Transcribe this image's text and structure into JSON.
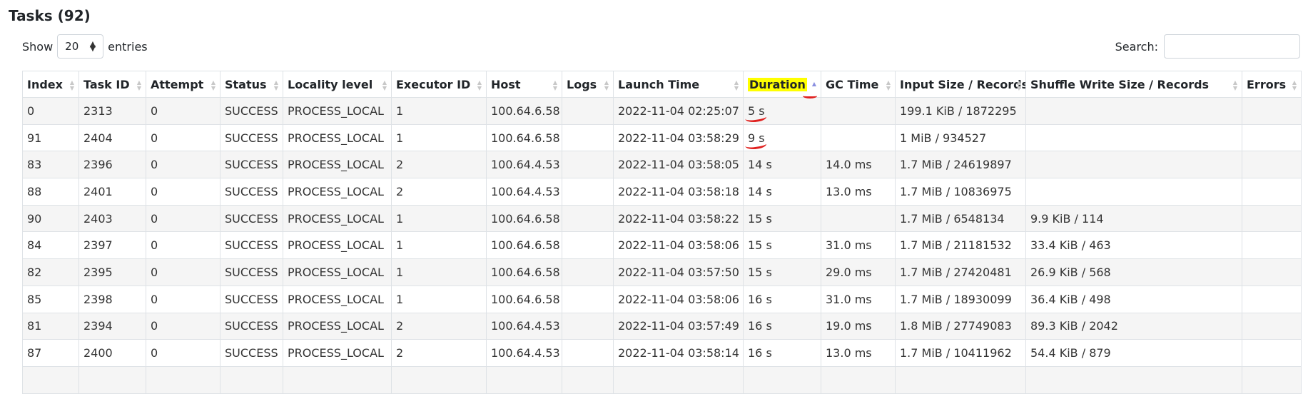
{
  "header": {
    "title": "Tasks (92)"
  },
  "length_menu": {
    "show_label": "Show",
    "value": "20",
    "entries_label": "entries"
  },
  "search": {
    "label": "Search:",
    "value": "",
    "placeholder": ""
  },
  "table": {
    "sorted_column": "Duration",
    "sort_direction": "ascending",
    "highlight_color": "#ffff00",
    "annotation_color": "#e0201e",
    "columns": [
      "Index",
      "Task ID",
      "Attempt",
      "Status",
      "Locality level",
      "Executor ID",
      "Host",
      "Logs",
      "Launch Time",
      "Duration",
      "GC Time",
      "Input Size / Records",
      "Shuffle Write Size / Records",
      "Errors"
    ],
    "rows": [
      [
        "0",
        "2313",
        "0",
        "SUCCESS",
        "PROCESS_LOCAL",
        "1",
        "100.64.6.58",
        "",
        "2022-11-04 02:25:07",
        "5 s",
        "",
        "199.1 KiB / 1872295",
        "",
        ""
      ],
      [
        "91",
        "2404",
        "0",
        "SUCCESS",
        "PROCESS_LOCAL",
        "1",
        "100.64.6.58",
        "",
        "2022-11-04 03:58:29",
        "9 s",
        "",
        "1 MiB / 934527",
        "",
        ""
      ],
      [
        "83",
        "2396",
        "0",
        "SUCCESS",
        "PROCESS_LOCAL",
        "2",
        "100.64.4.53",
        "",
        "2022-11-04 03:58:05",
        "14 s",
        "14.0 ms",
        "1.7 MiB / 24619897",
        "",
        ""
      ],
      [
        "88",
        "2401",
        "0",
        "SUCCESS",
        "PROCESS_LOCAL",
        "2",
        "100.64.4.53",
        "",
        "2022-11-04 03:58:18",
        "14 s",
        "13.0 ms",
        "1.7 MiB / 10836975",
        "",
        ""
      ],
      [
        "90",
        "2403",
        "0",
        "SUCCESS",
        "PROCESS_LOCAL",
        "1",
        "100.64.6.58",
        "",
        "2022-11-04 03:58:22",
        "15 s",
        "",
        "1.7 MiB / 6548134",
        "9.9 KiB / 114",
        ""
      ],
      [
        "84",
        "2397",
        "0",
        "SUCCESS",
        "PROCESS_LOCAL",
        "1",
        "100.64.6.58",
        "",
        "2022-11-04 03:58:06",
        "15 s",
        "31.0 ms",
        "1.7 MiB / 21181532",
        "33.4 KiB / 463",
        ""
      ],
      [
        "82",
        "2395",
        "0",
        "SUCCESS",
        "PROCESS_LOCAL",
        "1",
        "100.64.6.58",
        "",
        "2022-11-04 03:57:50",
        "15 s",
        "29.0 ms",
        "1.7 MiB / 27420481",
        "26.9 KiB / 568",
        ""
      ],
      [
        "85",
        "2398",
        "0",
        "SUCCESS",
        "PROCESS_LOCAL",
        "1",
        "100.64.6.58",
        "",
        "2022-11-04 03:58:06",
        "16 s",
        "31.0 ms",
        "1.7 MiB / 18930099",
        "36.4 KiB / 498",
        ""
      ],
      [
        "81",
        "2394",
        "0",
        "SUCCESS",
        "PROCESS_LOCAL",
        "2",
        "100.64.4.53",
        "",
        "2022-11-04 03:57:49",
        "16 s",
        "19.0 ms",
        "1.8 MiB / 27749083",
        "89.3 KiB / 2042",
        ""
      ],
      [
        "87",
        "2400",
        "0",
        "SUCCESS",
        "PROCESS_LOCAL",
        "2",
        "100.64.4.53",
        "",
        "2022-11-04 03:58:14",
        "16 s",
        "13.0 ms",
        "1.7 MiB / 10411962",
        "54.4 KiB / 879",
        ""
      ],
      [
        "",
        "",
        "",
        "",
        "",
        "",
        "",
        "",
        "",
        "",
        "",
        "",
        "",
        ""
      ]
    ]
  }
}
